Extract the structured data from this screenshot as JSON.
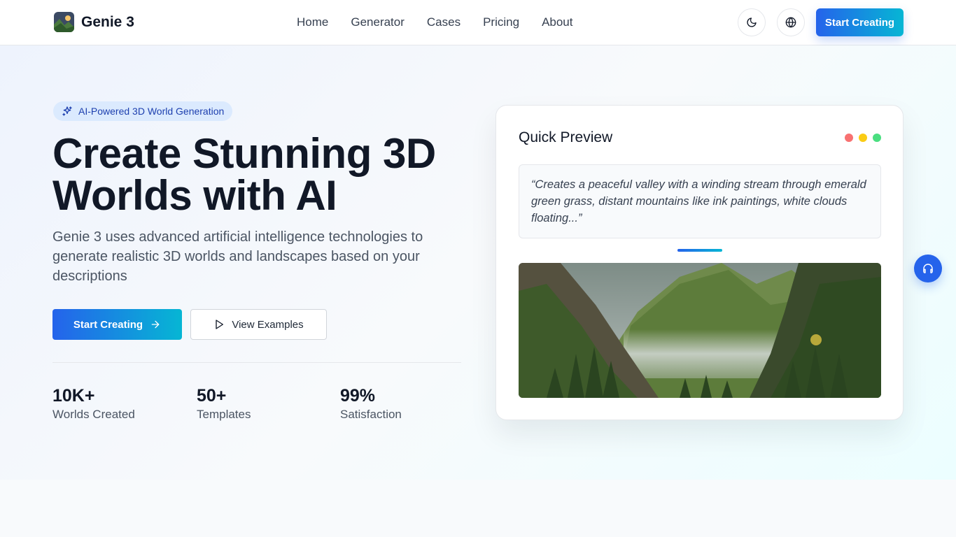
{
  "header": {
    "brand": "Genie 3",
    "nav": [
      "Home",
      "Generator",
      "Cases",
      "Pricing",
      "About"
    ],
    "cta_label": "Start Creating",
    "icons": {
      "theme": "moon-icon",
      "language": "globe-icon"
    }
  },
  "hero": {
    "badge": "AI-Powered 3D World Generation",
    "title_line1": "Create Stunning 3D",
    "title_line2": "Worlds with AI",
    "subtitle": "Genie 3 uses advanced artificial intelligence technologies to generate realistic 3D worlds and landscapes based on your descriptions",
    "primary_button": "Start Creating",
    "secondary_button": "View Examples",
    "stats": [
      {
        "value": "10K+",
        "label": "Worlds Created"
      },
      {
        "value": "50+",
        "label": "Templates"
      },
      {
        "value": "99%",
        "label": "Satisfaction"
      }
    ]
  },
  "preview": {
    "title": "Quick Preview",
    "prompt": "“Creates a peaceful valley with a winding stream through emerald green grass, distant mountains like ink paintings, white clouds floating...”",
    "window_dots": [
      "#f87171",
      "#facc15",
      "#4ade80"
    ]
  },
  "colors": {
    "accent": "#2563eb",
    "accent_end": "#06b6d4",
    "badge_bg": "#dbeafe"
  }
}
